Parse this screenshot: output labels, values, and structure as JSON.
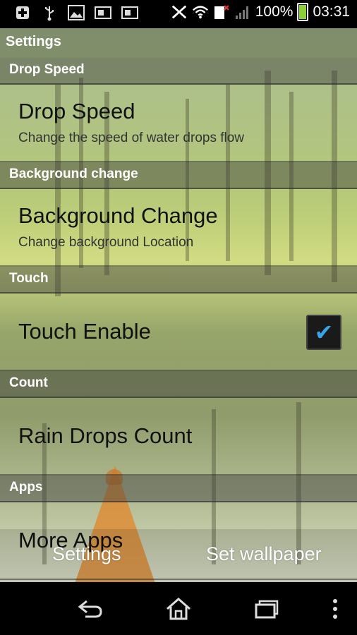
{
  "status_bar": {
    "battery_percent": "100%",
    "time": "03:31",
    "icons_left": [
      "plus-icon",
      "usb-icon",
      "image-icon",
      "sim-icon",
      "sim-icon"
    ],
    "icons_right": [
      "nfc-icon",
      "wifi-icon",
      "no-sim-icon",
      "signal-icon",
      "battery-icon"
    ]
  },
  "header": {
    "title": "Settings"
  },
  "sections": [
    {
      "category": "Drop Speed",
      "title": "Drop Speed",
      "summary": "Change the speed of water drops flow"
    },
    {
      "category": "Background change",
      "title": "Background Change",
      "summary": "Change background Location"
    },
    {
      "category": "Touch",
      "title": "Touch Enable",
      "checked": true
    },
    {
      "category": "Count",
      "title": "Rain Drops Count"
    },
    {
      "category": "Apps",
      "title": "More Apps"
    }
  ],
  "actions": {
    "settings": "Settings",
    "set_wallpaper": "Set wallpaper"
  },
  "nav": [
    "back-icon",
    "home-icon",
    "recent-apps-icon",
    "menu-icon"
  ],
  "colors": {
    "check_accent": "#3aa3e6",
    "battery": "#8ccf3b"
  }
}
